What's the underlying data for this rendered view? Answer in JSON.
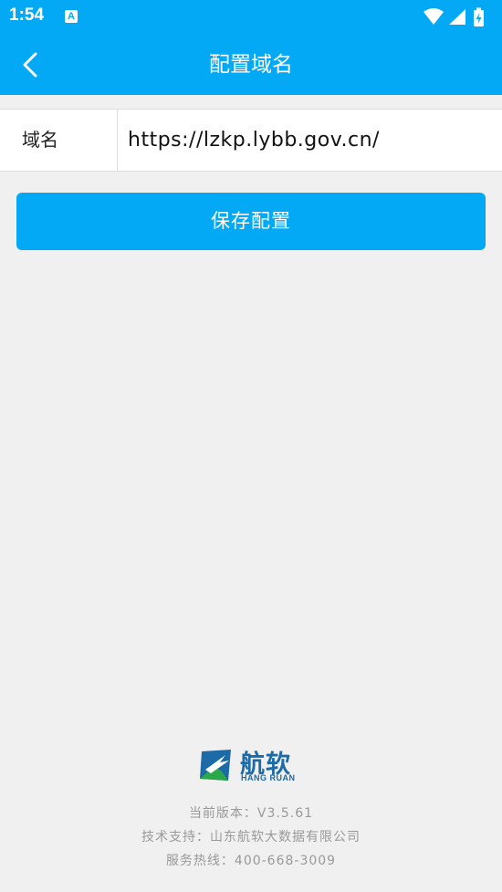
{
  "status_bar": {
    "time": "1:54",
    "notification_glyph": "A"
  },
  "header": {
    "title": "配置域名"
  },
  "domain_field": {
    "label": "域名",
    "value": "https://lzkp.lybb.gov.cn/"
  },
  "actions": {
    "save_label": "保存配置"
  },
  "footer": {
    "logo_text_cn": "航软",
    "logo_text_en": "HANG RUAN",
    "version": "当前版本：V3.5.61",
    "support": "技术支持：山东航软大数据有限公司",
    "hotline": "服务热线：400-668-3009"
  },
  "colors": {
    "primary": "#03a9f4",
    "background": "#f0f0f0",
    "logo_blue": "#1c6aa6",
    "logo_green": "#2aa84a",
    "footer_text": "#999999"
  },
  "icons": {
    "back": "chevron-left-icon",
    "wifi": "wifi-icon",
    "signal": "signal-icon",
    "battery": "battery-charging-icon"
  }
}
